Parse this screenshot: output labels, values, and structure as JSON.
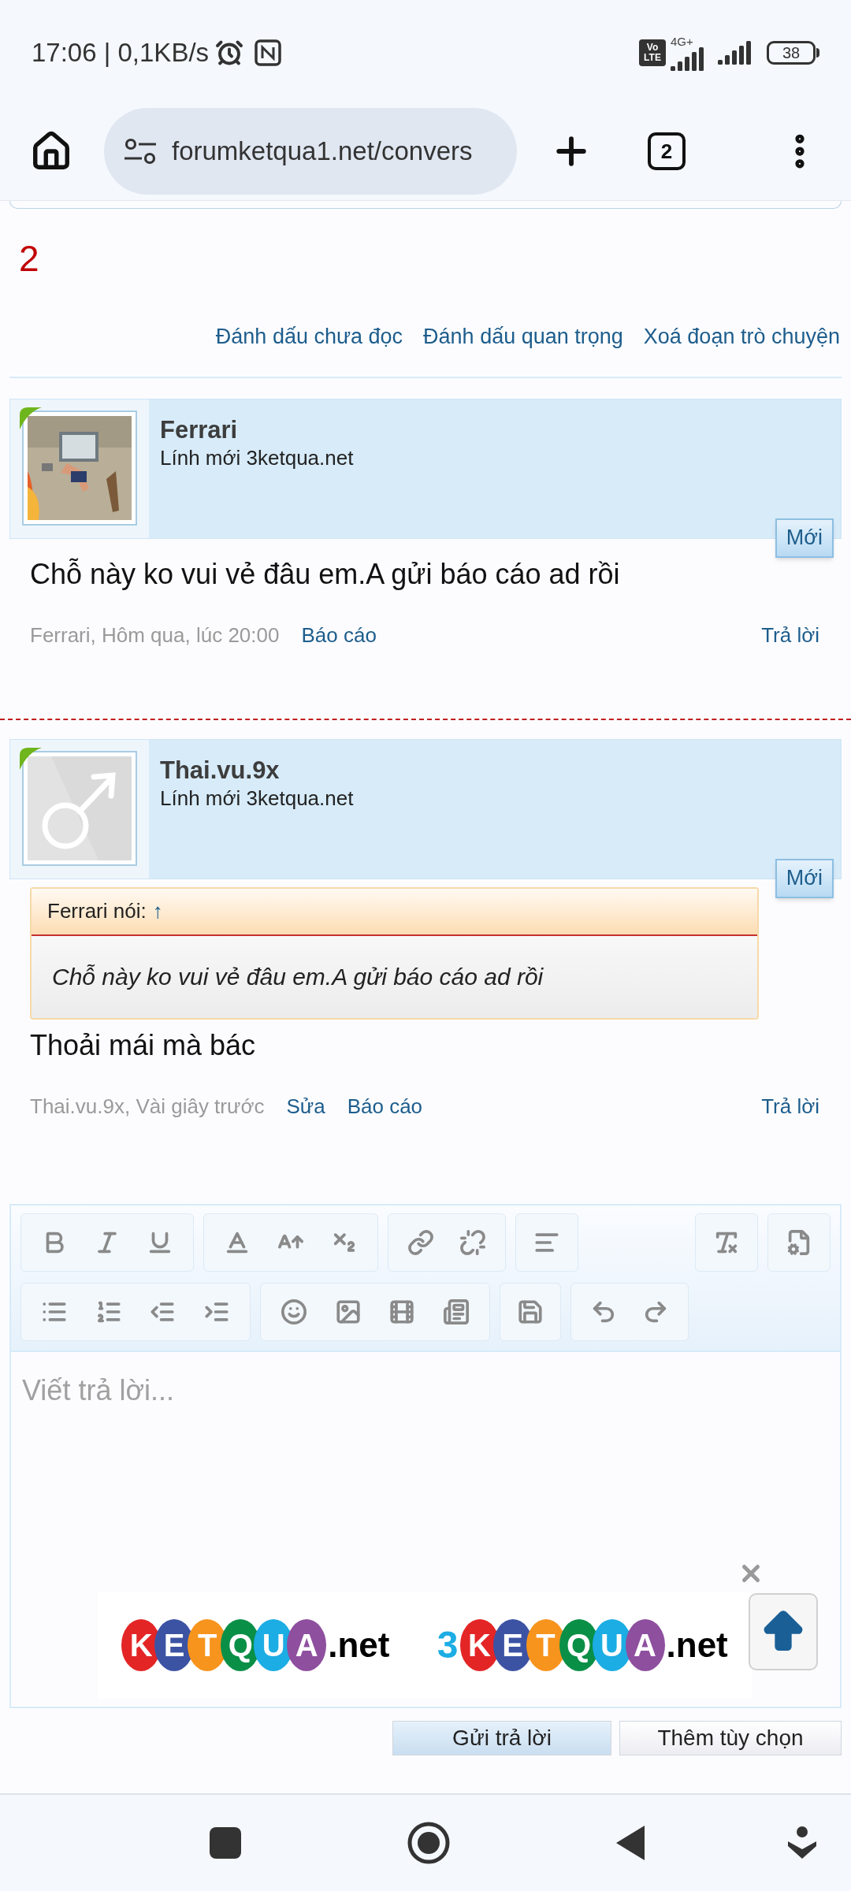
{
  "status_bar": {
    "time": "17:06 | 0,1KB/s",
    "volte": [
      "Vo",
      "LTE"
    ],
    "network_type": "4G+",
    "battery": "38"
  },
  "browser": {
    "url": "forumketqua1.net/convers",
    "tab_count": "2"
  },
  "conversation": {
    "reply_count": "2",
    "actions": [
      "Đánh dấu chưa đọc",
      "Đánh dấu quan trọng",
      "Xoá đoạn trò chuyện"
    ]
  },
  "messages": [
    {
      "author": "Ferrari",
      "user_title": "Lính mới 3ketqua.net",
      "avatar": {
        "kind": "picture"
      },
      "badge": "Mới",
      "body": "Chỗ này ko vui vẻ đâu em.A gửi báo cáo ad rồi",
      "meta": "Ferrari, Hôm qua, lúc 20:00",
      "links": [
        "Báo cáo"
      ],
      "reply": "Trả lời"
    },
    {
      "author": "Thai.vu.9x",
      "user_title": "Lính mới 3ketqua.net",
      "avatar": {
        "kind": "default"
      },
      "badge": "Mới",
      "quote": {
        "author": "Ferrari nói:",
        "arrow": "↑",
        "text": "Chỗ này ko vui vẻ đâu em.A gửi báo cáo ad rồi"
      },
      "body": "Thoải mái mà bác",
      "meta": "Thai.vu.9x, Vài giây trước",
      "links": [
        "Sửa",
        "Báo cáo"
      ],
      "reply": "Trả lời"
    }
  ],
  "editor": {
    "placeholder": "Viết trả lời...",
    "ads": [
      {
        "suffix": ".net",
        "letters": [
          {
            "char": "K",
            "color": "#e32526"
          },
          {
            "char": "E",
            "color": "#3c53a4"
          },
          {
            "char": "T",
            "color": "#f7941d"
          },
          {
            "char": "Q",
            "color": "#0a8f47"
          },
          {
            "char": "U",
            "color": "#1cade4"
          },
          {
            "char": "A",
            "color": "#8e4f9f"
          }
        ]
      },
      {
        "prefix": "3",
        "suffix": ".net",
        "letters": [
          {
            "char": "K",
            "color": "#e32526"
          },
          {
            "char": "E",
            "color": "#3c53a4"
          },
          {
            "char": "T",
            "color": "#f7941d"
          },
          {
            "char": "Q",
            "color": "#0a8f47"
          },
          {
            "char": "U",
            "color": "#1cade4"
          },
          {
            "char": "A",
            "color": "#8e4f9f"
          }
        ]
      }
    ]
  },
  "buttons": [
    "Gửi trả lời",
    "Thêm tùy chọn"
  ]
}
